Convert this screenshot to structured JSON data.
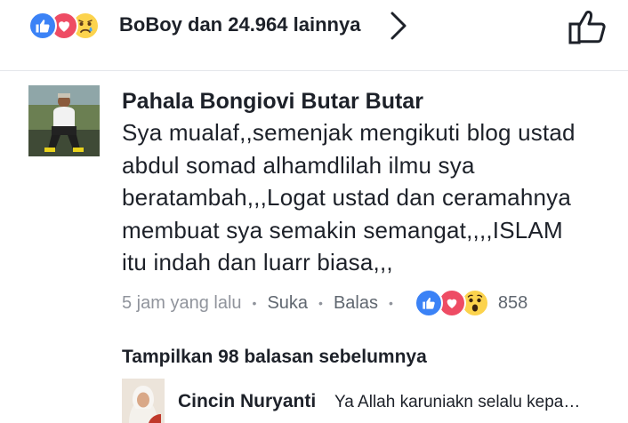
{
  "reactions_bar": {
    "summary": "BoBoy dan 24.964 lainnya",
    "icons": [
      "like-icon",
      "love-icon",
      "sad-icon"
    ]
  },
  "comment": {
    "author": "Pahala Bongiovi Butar Butar",
    "text": "Sya mualaf,,semenjak mengikuti blog ustad\nabdul somad alhamdlilah ilmu sya\nberatambah,,,Logat ustad dan ceramahnya\nmembuat sya semakin  semangat,,,,ISLAM\nitu indah dan luarr biasa,,,",
    "timestamp": "5 jam yang lalu",
    "like_label": "Suka",
    "reply_label": "Balas",
    "reaction_count": "858",
    "reaction_icons": [
      "like-icon",
      "love-icon",
      "wow-icon"
    ]
  },
  "replies": {
    "show_previous": "Tampilkan 98 balasan sebelumnya",
    "latest": {
      "author": "Cincin Nuryanti",
      "text": "Ya Allah karuniakn selalu kepa…"
    }
  },
  "colors": {
    "like_blue": "#3b82f6",
    "love_red": "#ee4c64",
    "emoji_yellow": "#fcd34d",
    "meta_gray": "#90949c"
  }
}
